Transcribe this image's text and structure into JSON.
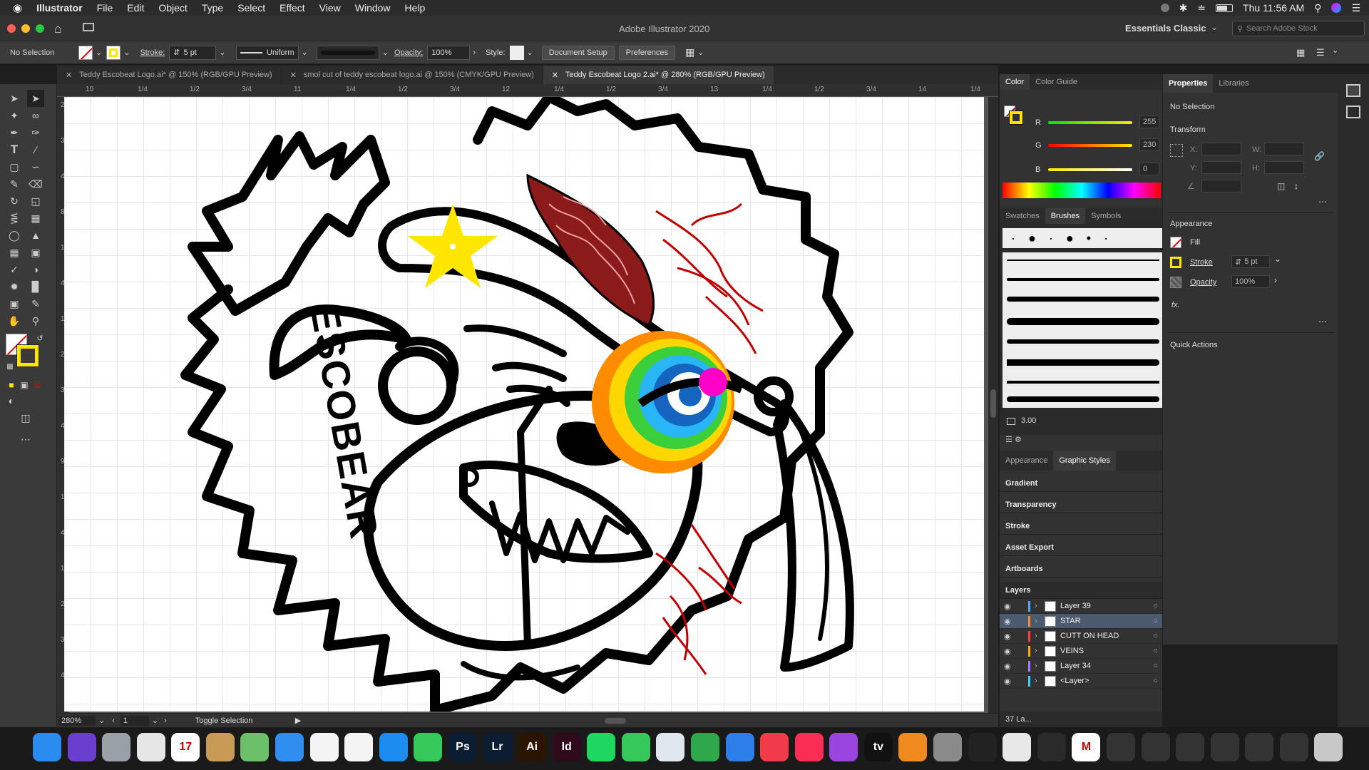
{
  "menubar": {
    "app_name": "Illustrator",
    "items": [
      "File",
      "Edit",
      "Object",
      "Type",
      "Select",
      "Effect",
      "View",
      "Window",
      "Help"
    ],
    "clock": "Thu 11:56 AM"
  },
  "titlebar": {
    "title": "Adobe Illustrator 2020",
    "workspace": "Essentials Classic",
    "search_placeholder": "Search Adobe Stock"
  },
  "controlbar": {
    "selection": "No Selection",
    "stroke_label": "Stroke:",
    "stroke_weight": "5 pt",
    "profile": "Uniform",
    "opacity_label": "Opacity:",
    "opacity": "100%",
    "style_label": "Style:",
    "document_setup": "Document Setup",
    "preferences": "Preferences"
  },
  "tabs": [
    {
      "label": "Teddy Escobeat Logo.ai* @ 150% (RGB/GPU Preview)",
      "active": false
    },
    {
      "label": "smol cut of teddy escobeat logo.ai @ 150% (CMYK/GPU Preview)",
      "active": false
    },
    {
      "label": "Teddy Escobeat Logo 2.ai* @ 280% (RGB/GPU Preview)",
      "active": true
    }
  ],
  "ruler": {
    "top_labels": [
      "10",
      "1/4",
      "1/2",
      "3/4",
      "11",
      "1/4",
      "1/2",
      "3/4",
      "12",
      "1/4",
      "1/2",
      "3/4",
      "13",
      "1/4",
      "1/2",
      "3/4",
      "14",
      "1/4"
    ],
    "left_labels": [
      "2",
      "3",
      "4",
      "8",
      "1",
      "4",
      "1",
      "2",
      "3",
      "4",
      "9",
      "1",
      "4",
      "1",
      "2",
      "3",
      "4"
    ]
  },
  "artwork": {
    "text": "ESCOBEAR",
    "colors": {
      "star": "#ffe600",
      "vein": "#c00000",
      "brain": "#8b1a1a",
      "eye_magenta": "#ff00c8"
    }
  },
  "statusbar": {
    "zoom": "280%",
    "artboard_number": "1",
    "mode": "Toggle Selection"
  },
  "color_panel": {
    "tabs": [
      "Color",
      "Color Guide"
    ],
    "r_label": "R",
    "r": "255",
    "g_label": "G",
    "g": "230",
    "b_label": "B",
    "b": "0"
  },
  "brushes_panel": {
    "tabs": [
      "Swatches",
      "Brushes",
      "Symbols"
    ],
    "size": "3.00"
  },
  "appearance_tabs": [
    "Appearance",
    "Graphic Styles"
  ],
  "collapsed_panels": [
    "Gradient",
    "Transparency",
    "Stroke",
    "Asset Export",
    "Artboards"
  ],
  "layers_panel": {
    "title": "Layers",
    "layers": [
      {
        "name": "Layer 39",
        "color": "#4fa6ff"
      },
      {
        "name": "STAR",
        "color": "#ff8c2a",
        "selected": true
      },
      {
        "name": "CUTT ON HEAD",
        "color": "#ff4040"
      },
      {
        "name": "VEINS",
        "color": "#ffaa00"
      },
      {
        "name": "Layer 34",
        "color": "#a07aff"
      },
      {
        "name": "<Layer>",
        "color": "#40d0ff"
      }
    ],
    "count": "37 La..."
  },
  "properties_panel": {
    "tabs": [
      "Properties",
      "Libraries"
    ],
    "selection": "No Selection",
    "transform_title": "Transform",
    "x_label": "X:",
    "y_label": "Y:",
    "w_label": "W:",
    "h_label": "H:",
    "appearance_title": "Appearance",
    "fill_label": "Fill",
    "stroke_label": "Stroke",
    "stroke_value": "5 pt",
    "opacity_label": "Opacity",
    "opacity_value": "100%",
    "fx_label": "fx.",
    "quick_actions": "Quick Actions"
  },
  "dock": {
    "apps": [
      {
        "name": "Finder",
        "color": "#2a8cf0",
        "glyph": ""
      },
      {
        "name": "Siri",
        "color": "#6a3fd0",
        "glyph": ""
      },
      {
        "name": "Launchpad",
        "color": "#9aa0a8",
        "glyph": ""
      },
      {
        "name": "Chrome",
        "color": "#e6e6e6",
        "glyph": ""
      },
      {
        "name": "Calendar",
        "color": "#ffffff",
        "glyph": "17"
      },
      {
        "name": "Notes",
        "color": "#c79a56",
        "glyph": ""
      },
      {
        "name": "Maps",
        "color": "#6cc06a",
        "glyph": ""
      },
      {
        "name": "Safari",
        "color": "#2f8ef0",
        "glyph": ""
      },
      {
        "name": "Photos",
        "color": "#f4f4f4",
        "glyph": ""
      },
      {
        "name": "Reminders",
        "color": "#f4f4f4",
        "glyph": ""
      },
      {
        "name": "App Store",
        "color": "#1d8cf0",
        "glyph": ""
      },
      {
        "name": "Messages",
        "color": "#35c85a",
        "glyph": ""
      },
      {
        "name": "Photoshop",
        "color": "#0b1d33",
        "glyph": "Ps"
      },
      {
        "name": "Lightroom",
        "color": "#0b1d33",
        "glyph": "Lr"
      },
      {
        "name": "Illustrator",
        "color": "#2b1400",
        "glyph": "Ai"
      },
      {
        "name": "InDesign",
        "color": "#2e0a1b",
        "glyph": "Id"
      },
      {
        "name": "Spotify",
        "color": "#1ed760",
        "glyph": ""
      },
      {
        "name": "FaceTime",
        "color": "#35c85a",
        "glyph": ""
      },
      {
        "name": "Preview",
        "color": "#dfe7ef",
        "glyph": ""
      },
      {
        "name": "Numbers",
        "color": "#2ea84a",
        "glyph": ""
      },
      {
        "name": "Keynote",
        "color": "#2d7ee8",
        "glyph": ""
      },
      {
        "name": "News",
        "color": "#f23b4a",
        "glyph": ""
      },
      {
        "name": "Music",
        "color": "#fa2d55",
        "glyph": ""
      },
      {
        "name": "Podcasts",
        "color": "#9b45e0",
        "glyph": ""
      },
      {
        "name": "TV",
        "color": "#111111",
        "glyph": "tv"
      },
      {
        "name": "Books",
        "color": "#f08a1e",
        "glyph": ""
      },
      {
        "name": "System Preferences",
        "color": "#8a8a8a",
        "glyph": ""
      },
      {
        "name": "Activity Monitor",
        "color": "#222222",
        "glyph": ""
      },
      {
        "name": "TextEdit",
        "color": "#e8e8e8",
        "glyph": ""
      },
      {
        "name": "Acrobat",
        "color": "#2a2a2a",
        "glyph": ""
      },
      {
        "name": "Gmail",
        "color": "#ffffff",
        "glyph": "M"
      },
      {
        "name": "Window 1",
        "color": "#333333",
        "glyph": ""
      },
      {
        "name": "Window 2",
        "color": "#333333",
        "glyph": ""
      },
      {
        "name": "Window 3",
        "color": "#333333",
        "glyph": ""
      },
      {
        "name": "Window 4",
        "color": "#333333",
        "glyph": ""
      },
      {
        "name": "Window 5",
        "color": "#333333",
        "glyph": ""
      },
      {
        "name": "Window 6",
        "color": "#333333",
        "glyph": ""
      },
      {
        "name": "Trash",
        "color": "#c8c8c8",
        "glyph": ""
      }
    ]
  }
}
